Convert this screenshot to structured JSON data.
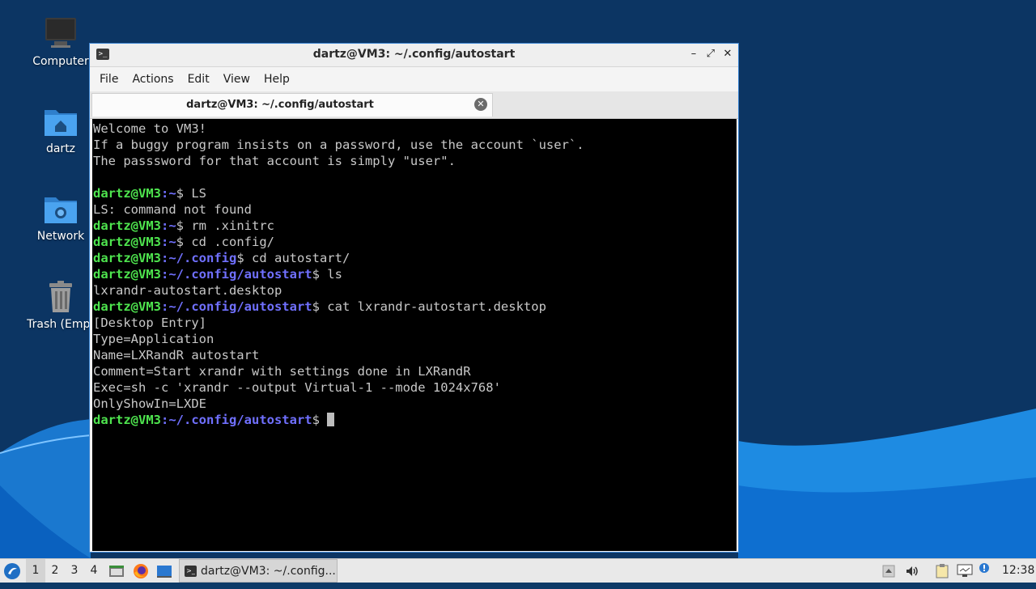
{
  "desktop": {
    "icons": [
      {
        "label": "Computer",
        "icon": "computer-icon"
      },
      {
        "label": "dartz",
        "icon": "home-folder-icon"
      },
      {
        "label": "Network",
        "icon": "network-folder-icon"
      },
      {
        "label": "Trash (Empt",
        "icon": "trash-icon"
      }
    ]
  },
  "window": {
    "title": "dartz@VM3: ~/.config/autostart",
    "icon": "terminal-icon",
    "menu": [
      "File",
      "Actions",
      "Edit",
      "View",
      "Help"
    ],
    "tab_label": "dartz@VM3: ~/.config/autostart"
  },
  "terminal": {
    "user_host": "dartz@VM3",
    "lines": [
      "Welcome to VM3!",
      "If a buggy program insists on a password, use the account `user`.",
      "The passsword for that account is simply \"user\".",
      "",
      "LS: command not found",
      "lxrandr-autostart.desktop",
      "[Desktop Entry]",
      "Type=Application",
      "Name=LXRandR autostart",
      "Comment=Start xrandr with settings done in LXRandR",
      "Exec=sh -c 'xrandr --output Virtual-1 --mode 1024x768'",
      "OnlyShowIn=LXDE"
    ],
    "prompts": [
      {
        "path": ":~",
        "cmd": "$ LS"
      },
      {
        "path": ":~",
        "cmd": "$ rm .xinitrc"
      },
      {
        "path": ":~",
        "cmd": "$ cd .config/"
      },
      {
        "path": ":~/.config",
        "cmd": "$ cd autostart/"
      },
      {
        "path": ":~/.config/autostart",
        "cmd": "$ ls"
      },
      {
        "path": ":~/.config/autostart",
        "cmd": "$ cat lxrandr-autostart.desktop"
      },
      {
        "path": ":~/.config/autostart",
        "cmd": "$ "
      }
    ]
  },
  "taskbar": {
    "workspaces": [
      "1",
      "2",
      "3",
      "4"
    ],
    "active_workspace": "1",
    "task_label": "dartz@VM3: ~/.config...",
    "clock": "12:38"
  },
  "colors": {
    "prompt_user": "#4ee44e",
    "prompt_path": "#7070ff",
    "accent": "#3f87d4"
  }
}
